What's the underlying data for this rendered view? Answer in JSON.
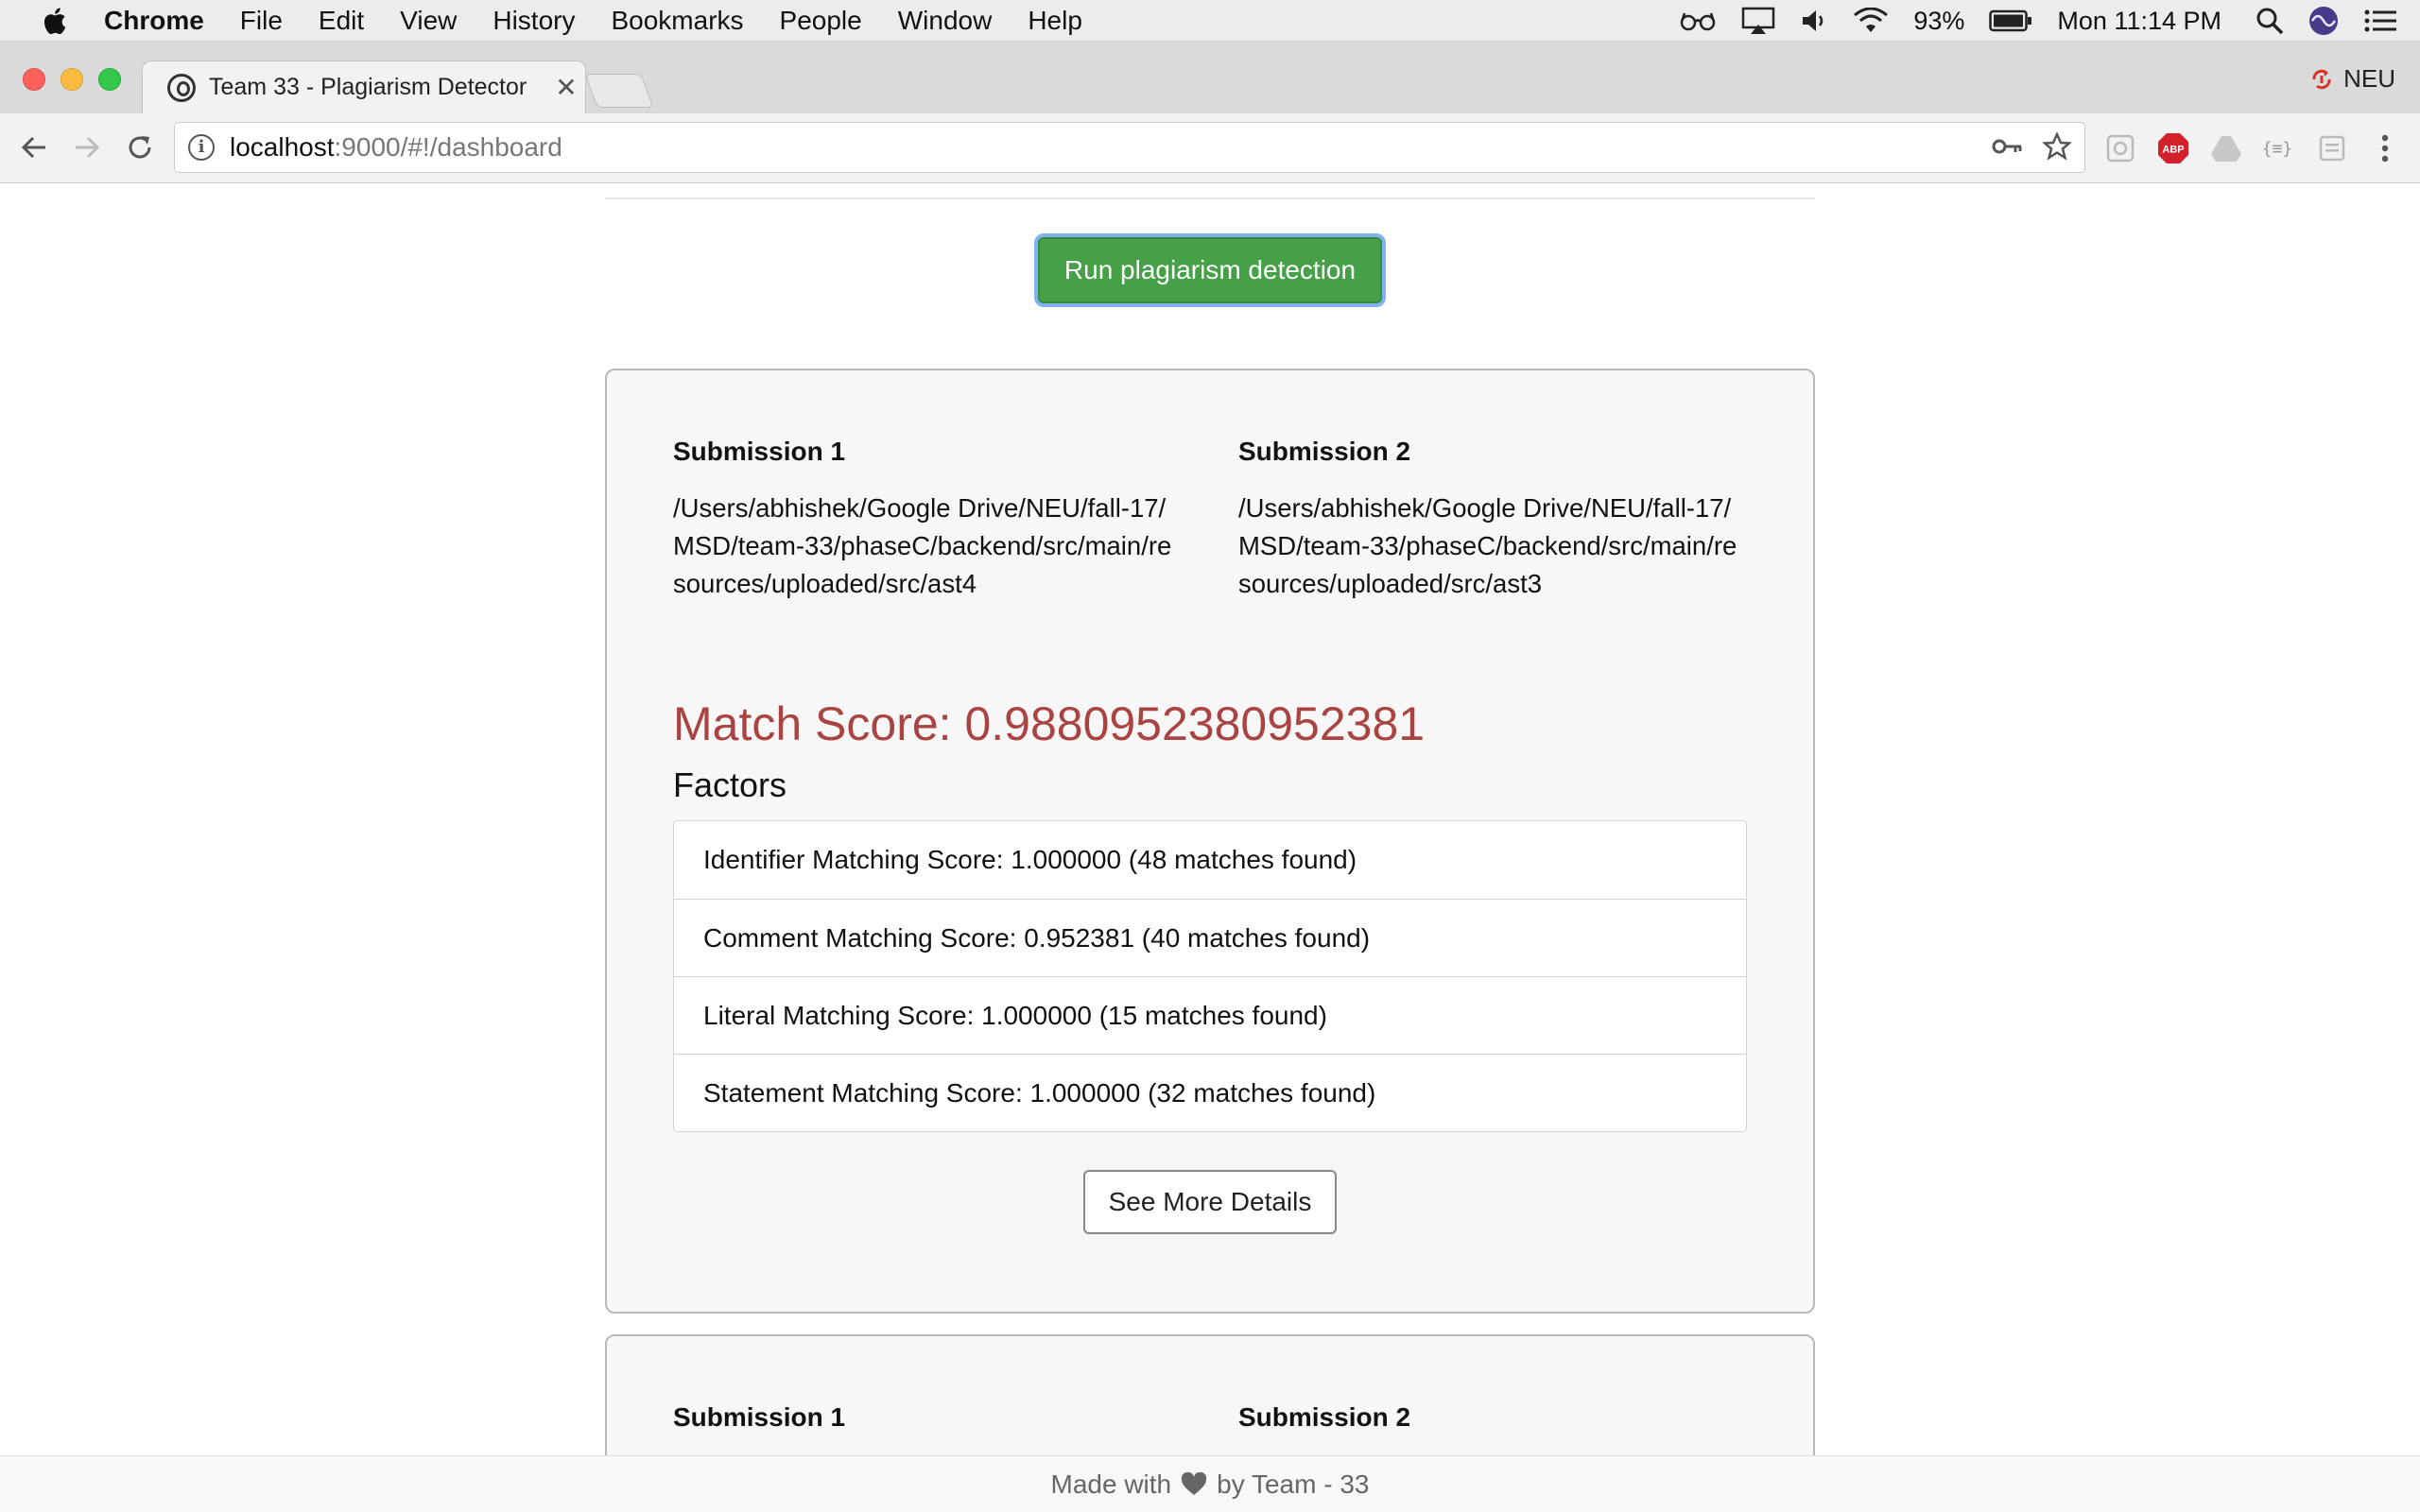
{
  "menubar": {
    "app": "Chrome",
    "items": [
      "File",
      "Edit",
      "View",
      "History",
      "Bookmarks",
      "People",
      "Window",
      "Help"
    ],
    "battery": "93%",
    "clock": "Mon 11:14 PM",
    "icons": [
      "glasses-icon",
      "airplay-icon",
      "volume-icon",
      "wifi-icon",
      "battery-icon",
      "spotlight-icon",
      "siri-icon",
      "notification-center-icon"
    ]
  },
  "browser": {
    "tab_title": "Team 33 - Plagiarism Detector",
    "profile_name": "NEU",
    "url_host": "localhost",
    "url_rest": ":9000/#!/dashboard"
  },
  "page": {
    "run_button": "Run plagiarism detection",
    "results": [
      {
        "submission1_label": "Submission 1",
        "submission1_path": "/Users/abhishek/Google Drive/NEU/fall-17/MSD/team-33/phaseC/backend/src/main/resources/uploaded/src/ast4",
        "submission2_label": "Submission 2",
        "submission2_path": "/Users/abhishek/Google Drive/NEU/fall-17/MSD/team-33/phaseC/backend/src/main/resources/uploaded/src/ast3",
        "match_score": "Match Score: 0.9880952380952381",
        "factors_title": "Factors",
        "factors": [
          "Identifier Matching Score: 1.000000 (48 matches found)",
          "Comment Matching Score: 0.952381 (40 matches found)",
          "Literal Matching Score: 1.000000 (15 matches found)",
          "Statement Matching Score: 1.000000 (32 matches found)"
        ],
        "details_button": "See More Details"
      },
      {
        "submission1_label": "Submission 1",
        "submission2_label": "Submission 2"
      }
    ]
  },
  "footer": {
    "before": "Made with",
    "after": "by Team - 33"
  },
  "colors": {
    "run_button": "#45a048",
    "match_score": "#a94442",
    "traffic_red": "#fc605c",
    "traffic_yellow": "#fdbc40",
    "traffic_green": "#34c84a"
  }
}
